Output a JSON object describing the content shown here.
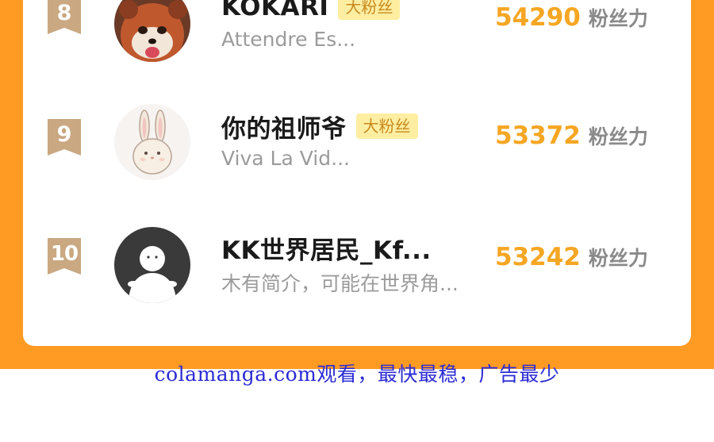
{
  "leaderboard": {
    "unit_label": "粉丝力",
    "entries": [
      {
        "rank": "8",
        "name": "KOKARI",
        "badge": "大粉丝",
        "bio": "Attendre Es...",
        "score": "54290",
        "avatar": "red-panda-avatar"
      },
      {
        "rank": "9",
        "name": "你的祖师爷",
        "badge": "大粉丝",
        "bio": "Viva La Vid...",
        "score": "53372",
        "avatar": "bunny-avatar"
      },
      {
        "rank": "10",
        "name": "KK世界居民_Kf...",
        "badge": "",
        "bio": "木有简介，可能在世界角...",
        "score": "53242",
        "avatar": "default-user-avatar"
      }
    ]
  },
  "footer": {
    "watermark": "colamanga.com观看，最快最稳，广告最少"
  },
  "colors": {
    "background": "#ff9a23",
    "score": "#f5a623",
    "badge_bg": "#fdeea2",
    "badge_text": "#c88a1e",
    "rank_badge": "#c9a882",
    "watermark": "#2b2bd6"
  }
}
